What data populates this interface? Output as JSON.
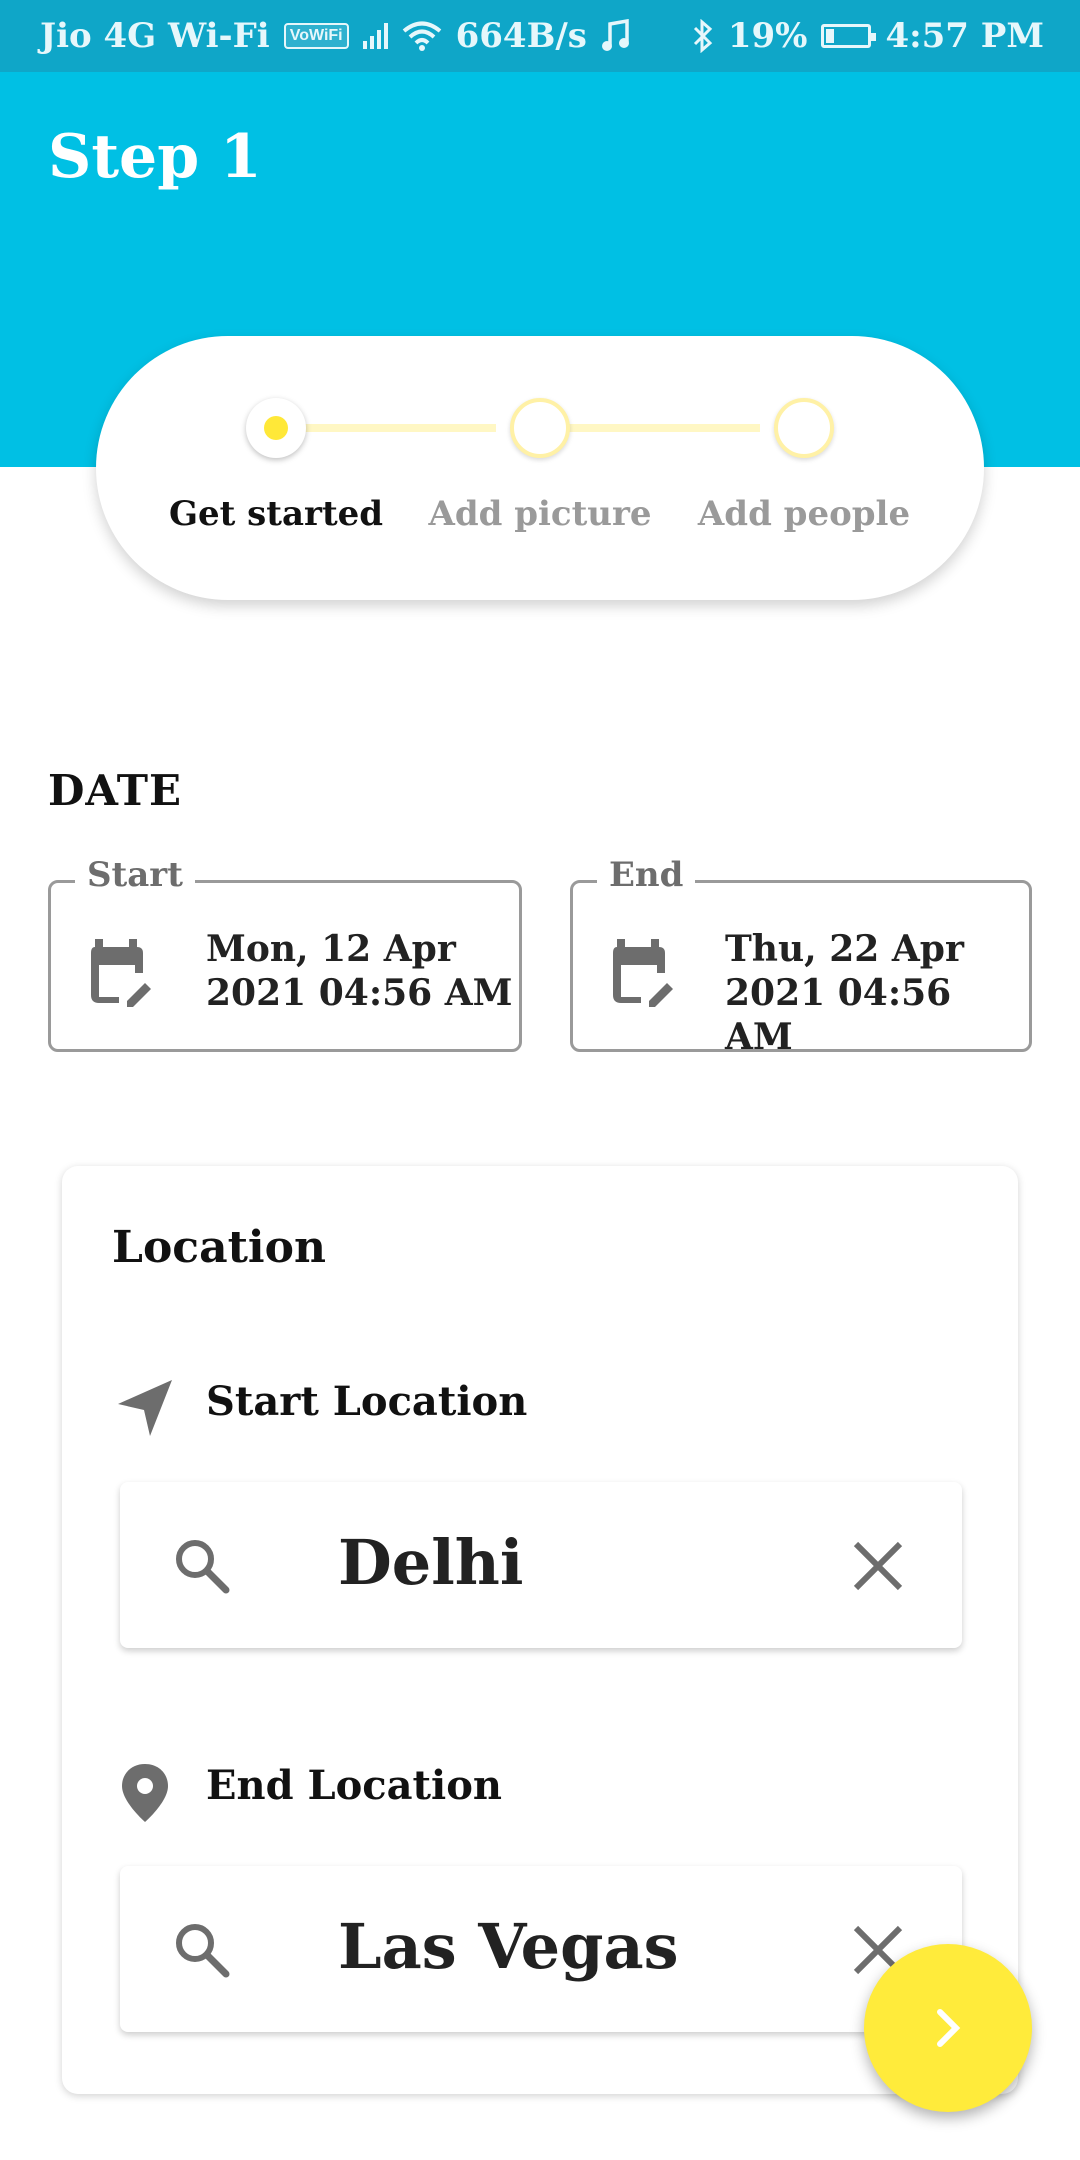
{
  "status_bar": {
    "carrier": "Jio 4G Wi-Fi",
    "vowifi": "VoWiFi",
    "speed": "664B/s",
    "battery": "19%",
    "battery_level": 0.19,
    "time": "4:57 PM"
  },
  "header": {
    "title": "Step 1"
  },
  "stepper": {
    "steps": [
      {
        "label": "Get started",
        "state": "active"
      },
      {
        "label": "Add picture",
        "state": "inactive"
      },
      {
        "label": "Add people",
        "state": "inactive"
      }
    ]
  },
  "date": {
    "title": "DATE",
    "start": {
      "legend": "Start",
      "line1": "Mon, 12 Apr",
      "line2": "2021 04:56 AM"
    },
    "end": {
      "legend": "End",
      "line1": "Thu, 22 Apr",
      "line2": "2021 04:56 AM"
    }
  },
  "location": {
    "title": "Location",
    "start": {
      "label": "Start Location",
      "value": "Delhi"
    },
    "end": {
      "label": "End Location",
      "value": "Las Vegas"
    }
  },
  "colors": {
    "header": "#00c0e4",
    "status_bar": "#0fa6c8",
    "accent": "#ffeb3b",
    "icon_gray": "#6d6d6d"
  },
  "icons": {
    "calendar": "calendar-edit-icon",
    "navigation": "navigation-arrow-icon",
    "pin": "location-pin-icon",
    "search": "search-icon",
    "clear": "close-icon",
    "next": "chevron-right-icon"
  }
}
